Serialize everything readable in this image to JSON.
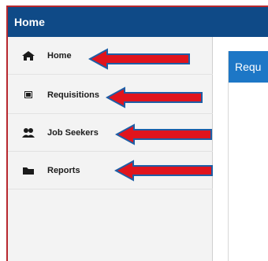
{
  "header": {
    "title": "Home"
  },
  "sidebar": {
    "items": [
      {
        "label": "Home",
        "icon": "home-icon"
      },
      {
        "label": "Requisitions",
        "icon": "book-icon"
      },
      {
        "label": "Job Seekers",
        "icon": "users-icon"
      },
      {
        "label": "Reports",
        "icon": "folder-icon"
      }
    ]
  },
  "panel": {
    "title": "Requ"
  },
  "colors": {
    "header_bg": "#0f4a87",
    "panel_header_bg": "#1d77c6",
    "arrow": "#e0141d",
    "arrow_border": "#1d5ea6",
    "outline": "#b7282e"
  }
}
